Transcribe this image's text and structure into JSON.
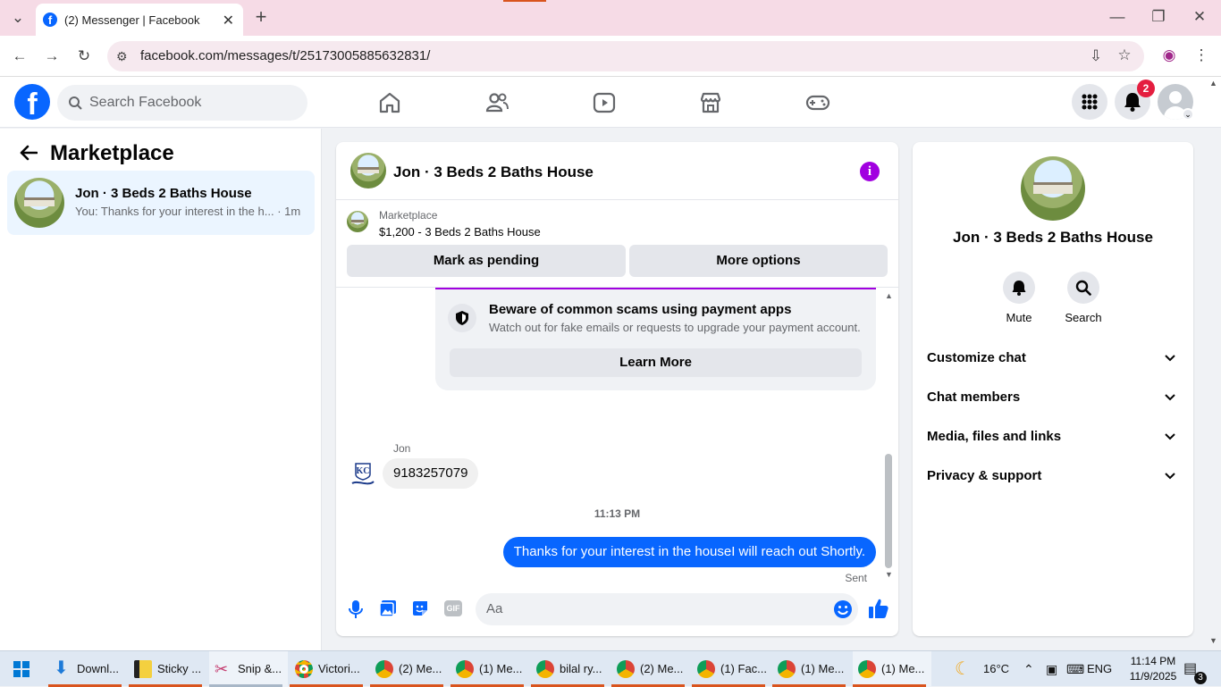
{
  "browser": {
    "tab_title": "(2) Messenger | Facebook",
    "url": "facebook.com/messages/t/25173005885632831/"
  },
  "fb_header": {
    "search_placeholder": "Search Facebook",
    "notification_count": "2"
  },
  "left_panel": {
    "title": "Marketplace",
    "conversation": {
      "name": "Jon · 3 Beds 2 Baths House",
      "preview": "You: Thanks for your interest in the h...",
      "time": "· 1m"
    }
  },
  "chat": {
    "title": "Jon · 3 Beds 2 Baths House",
    "listing_source": "Marketplace",
    "listing_summary": "$1,200 - 3 Beds 2 Baths House",
    "mark_pending_label": "Mark as pending",
    "more_options_label": "More options",
    "scam_card": {
      "title": "Beware of common scams using payment apps",
      "subtitle": "Watch out for fake emails or requests to upgrade your payment account.",
      "button": "Learn More"
    },
    "received": {
      "sender": "Jon",
      "text": "9183257079"
    },
    "timestamp": "11:13 PM",
    "sent": {
      "text": "Thanks for your interest in the houseI will reach out Shortly.",
      "status": "Sent"
    },
    "composer_placeholder": "Aa"
  },
  "right_panel": {
    "name": "Jon · 3 Beds 2 Baths House",
    "actions": [
      "Mute",
      "Search"
    ],
    "sections": [
      "Customize chat",
      "Chat members",
      "Media, files and links",
      "Privacy & support"
    ]
  },
  "taskbar": {
    "items": [
      "Downl...",
      "Sticky ...",
      "Snip &...",
      "Victori...",
      "(2) Me...",
      "(1) Me...",
      "bilal ry...",
      "(2) Me...",
      "(1) Fac...",
      "(1) Me...",
      "(1) Me..."
    ],
    "weather": "16°C",
    "language": "ENG",
    "time": "11:14 PM",
    "date": "11/9/2025",
    "notification_count": "3"
  },
  "colors": {
    "brand_blue": "#0866ff",
    "accent_purple": "#a100e0",
    "badge_red": "#e41e3f"
  }
}
